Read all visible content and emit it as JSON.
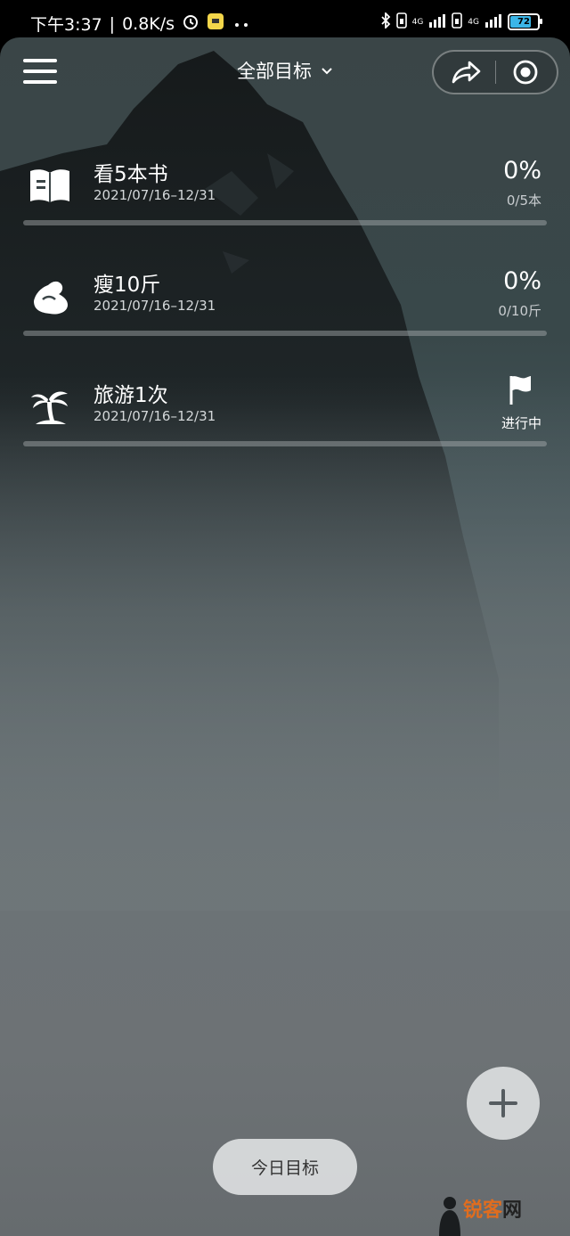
{
  "status_bar": {
    "time": "下午3:37",
    "speed": "0.8K/s",
    "sep": "|",
    "network1": "4G",
    "network2": "4G",
    "battery": "72"
  },
  "header": {
    "title": "全部目标"
  },
  "goals": [
    {
      "name": "看5本书",
      "dates": "2021/07/16–12/31",
      "percent": "0%",
      "count": "0/5本",
      "progress": 0,
      "icon": "book-icon"
    },
    {
      "name": "瘦10斤",
      "dates": "2021/07/16–12/31",
      "percent": "0%",
      "count": "0/10斤",
      "progress": 0,
      "icon": "muscle-icon"
    },
    {
      "name": "旅游1次",
      "dates": "2021/07/16–12/31",
      "status": "进行中",
      "progress": 0,
      "icon": "palm-tree-icon"
    }
  ],
  "bottom": {
    "today_label": "今日目标",
    "watermark": "锐客",
    "watermark2": "网"
  },
  "colors": {
    "accent_light": "#dcdee0",
    "progress_track": "#aaafb2",
    "watermark": "#e06d1f"
  }
}
